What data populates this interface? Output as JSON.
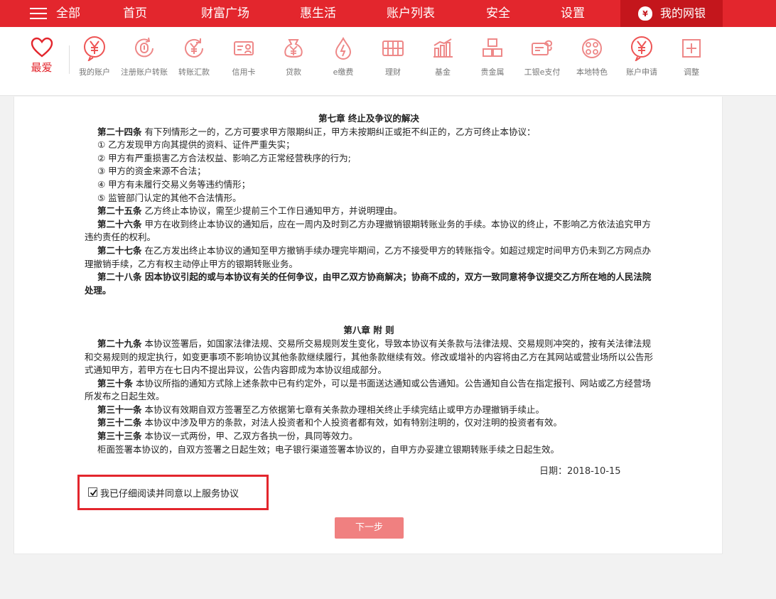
{
  "topnav": {
    "all_label": "全部",
    "items": [
      "首页",
      "财富广场",
      "惠生活",
      "账户列表",
      "安全",
      "设置"
    ],
    "mybank_label": "我的网银",
    "bg_color": "#e3262d"
  },
  "iconbar": {
    "favorite_label": "最爱",
    "tools": [
      {
        "label": "我的账户",
        "icon": "yen-circle-icon"
      },
      {
        "label": "注册账户转账",
        "icon": "register-transfer-icon"
      },
      {
        "label": "转账汇款",
        "icon": "transfer-icon"
      },
      {
        "label": "信用卡",
        "icon": "credit-card-icon"
      },
      {
        "label": "贷款",
        "icon": "loan-bag-icon"
      },
      {
        "label": "e缴费",
        "icon": "payment-drop-icon"
      },
      {
        "label": "理财",
        "icon": "finance-abacus-icon"
      },
      {
        "label": "基金",
        "icon": "fund-chart-icon"
      },
      {
        "label": "贵金属",
        "icon": "precious-metal-icon"
      },
      {
        "label": "工银e支付",
        "icon": "e-pay-icon"
      },
      {
        "label": "本地特色",
        "icon": "local-feature-icon"
      },
      {
        "label": "账户申请",
        "icon": "account-apply-icon"
      },
      {
        "label": "调整",
        "icon": "adjust-plus-icon"
      }
    ]
  },
  "doc": {
    "ch7_title": "第七章 终止及争议的解决",
    "a24_head": "第二十四条",
    "a24_text": " 有下列情形之一的，乙方可要求甲方限期纠正，甲方未按期纠正或拒不纠正的，乙方可终止本协议：",
    "a24_items": [
      "① 乙方发现甲方向其提供的资料、证件严重失实；",
      "② 甲方有严重损害乙方合法权益、影响乙方正常经营秩序的行为;",
      "③ 甲方的资金来源不合法；",
      "④ 甲方有未履行交易义务等违约情形；",
      "⑤ 监管部门认定的其他不合法情形。"
    ],
    "a25_head": "第二十五条",
    "a25_text": " 乙方终止本协议，需至少提前三个工作日通知甲方，并说明理由。",
    "a26_head": "第二十六条",
    "a26_text": " 甲方在收到终止本协议的通知后，应在一周内及时到乙方办理撤销银期转账业务的手续。本协议的终止，不影响乙方依法追究甲方违约责任的权利。",
    "a27_head": "第二十七条",
    "a27_text": " 在乙方发出终止本协议的通知至甲方撤销手续办理完毕期间，乙方不接受甲方的转账指令。如超过规定时间甲方仍未到乙方网点办理撤销手续，乙方有权主动停止甲方的银期转账业务。",
    "a28_bold": "第二十八条  因本协议引起的或与本协议有关的任何争议，由甲乙双方协商解决；协商不成的，双方一致同意将争议提交乙方所在地的人民法院处理。",
    "ch8_title": "第八章 附 则",
    "a29_head": "第二十九条",
    "a29_text": " 本协议签署后，如国家法律法规、交易所交易规则发生变化，导致本协议有关条款与法律法规、交易规则冲突的，按有关法律法规和交易规则的规定执行，如变更事项不影响协议其他条款继续履行，其他条款继续有效。修改或增补的内容将由乙方在其网站或营业场所以公告形式通知甲方，若甲方在七日内不提出异议，公告内容即成为本协议组成部分。",
    "a30_head": "第三十条",
    "a30_text": " 本协议所指的通知方式除上述条款中已有约定外，可以是书面送达通知或公告通知。公告通知自公告在指定报刊、网站或乙方经营场所发布之日起生效。",
    "a31_head": "第三十一条",
    "a31_text": " 本协议有效期自双方签署至乙方依据第七章有关条款办理相关终止手续完结止或甲方办理撤销手续止。",
    "a32_head": "第三十二条",
    "a32_text": " 本协议中涉及甲方的条款，对法人投资者和个人投资者都有效，如有特别注明的，仅对注明的投资者有效。",
    "a33_head": "第三十三条",
    "a33_text": " 本协议一式两份，甲、乙双方各执一份，具同等效力。",
    "closing": "柜面签署本协议的，自双方签署之日起生效；电子银行渠道签署本协议的，自甲方办妥建立银期转账手续之日起生效。",
    "date": "日期：2018-10-15"
  },
  "agree": {
    "label": "我已仔细阅读并同意以上服务协议",
    "checked": true
  },
  "next_button": "下一步"
}
